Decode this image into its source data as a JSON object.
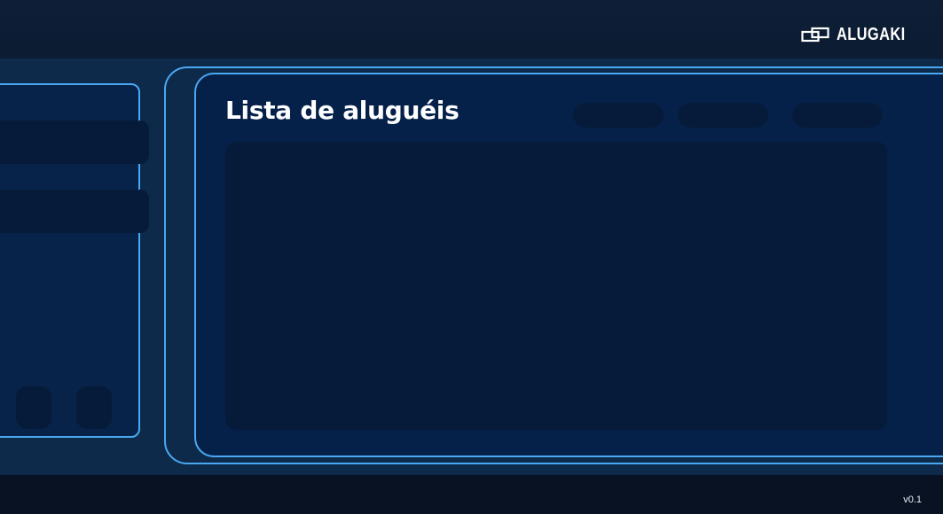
{
  "brand": {
    "name": "ALUGAKI",
    "logo_icon": "alugaki-logo-icon"
  },
  "main": {
    "title": "Lista de aluguéis"
  },
  "footer": {
    "version": "v0.1"
  },
  "colors": {
    "background": "#0a1628",
    "shell": "#0d2a4a",
    "panel": "#05214a",
    "placeholder": "#061b3a",
    "accent_border": "#4aa8f2",
    "text": "#ffffff"
  }
}
